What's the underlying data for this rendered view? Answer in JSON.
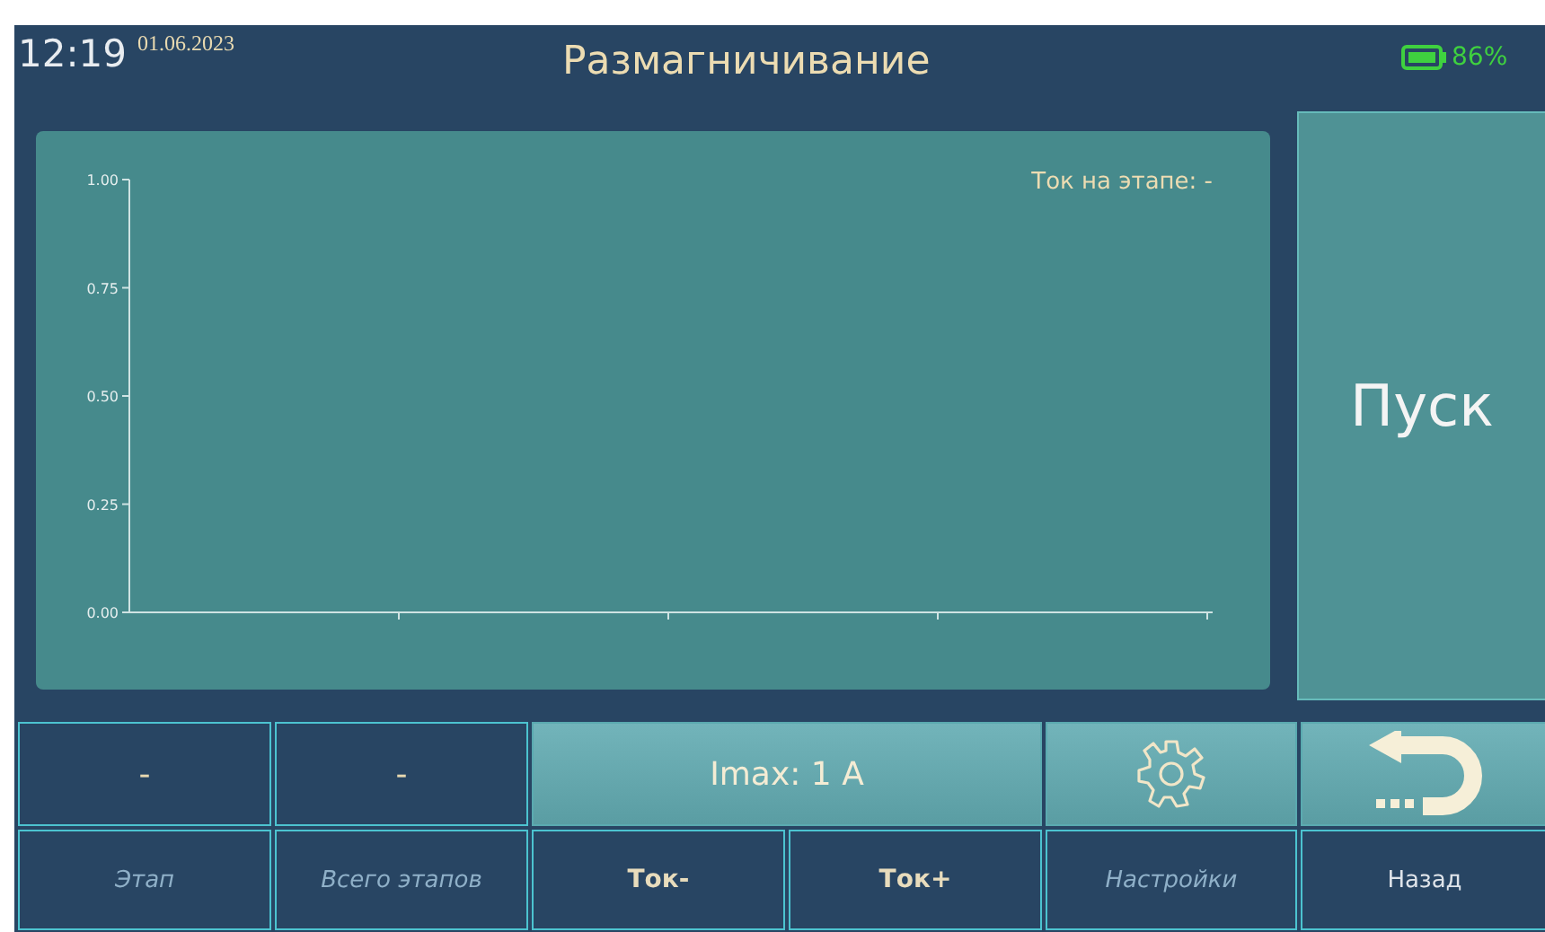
{
  "header": {
    "time": "12:19",
    "date": "01.06.2023",
    "title": "Размагничивание",
    "battery": "86%"
  },
  "chart": {
    "stage_current": "Ток на этапе: -",
    "chart_data": {
      "type": "line",
      "categories": [
        null,
        null,
        null,
        null,
        null
      ],
      "series": [
        {
          "values": [
            null,
            null,
            null,
            null,
            null
          ]
        }
      ],
      "ylim": [
        0,
        1
      ],
      "yticks": [
        {
          "value": 0,
          "label": "0.00"
        },
        {
          "value": 0.25,
          "label": "0.25"
        },
        {
          "value": 0.5,
          "label": "0.50"
        },
        {
          "value": 0.75,
          "label": "0.75"
        },
        {
          "value": 1,
          "label": "1.00"
        }
      ]
    }
  },
  "start_button": "Пуск",
  "readouts": [
    {
      "value": "-"
    },
    {
      "value": "-"
    }
  ],
  "imax_button": "Imax: 1 A",
  "labels": [
    {
      "text": "Этап",
      "kind": "caption"
    },
    {
      "text": "Всего этапов",
      "kind": "caption"
    },
    {
      "text": "Ток-",
      "kind": "action"
    },
    {
      "text": "Ток+",
      "kind": "action"
    },
    {
      "text": "Настройки",
      "kind": "caption"
    },
    {
      "text": "Назад",
      "kind": "plain"
    }
  ]
}
